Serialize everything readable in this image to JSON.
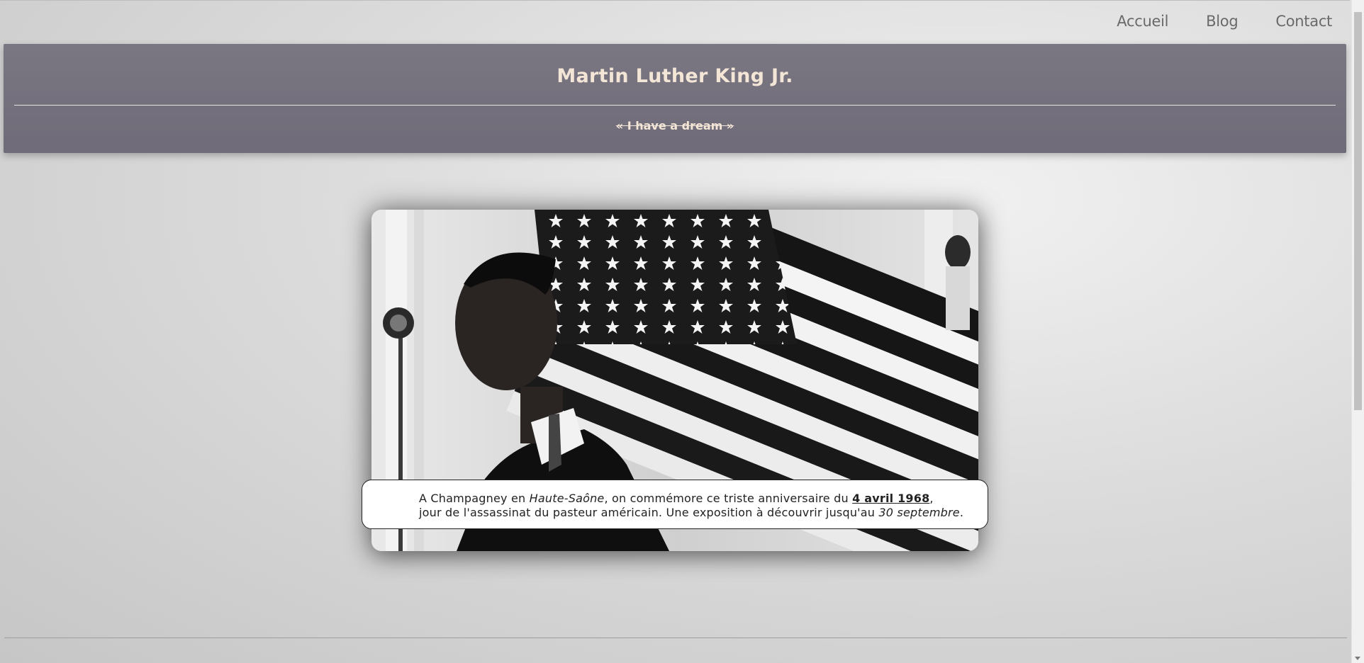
{
  "nav": {
    "items": [
      "Accueil",
      "Blog",
      "Contact"
    ]
  },
  "header": {
    "title": "Martin Luther King Jr.",
    "subtitle": "« I have a dream »"
  },
  "photo": {
    "description_icon": "portrait-photo"
  },
  "caption": {
    "line1_prefix": "A Champagney en ",
    "line1_place": "Haute-Saône",
    "line1_middle": ", on commémore ce triste anniversaire du ",
    "line1_date": "4 avril 1968",
    "line1_suffix": ",",
    "line2_prefix": "jour de l'assassinat du pasteur américain. Une exposition à découvrir jusqu'au ",
    "line2_end_date": "30 septembre",
    "line2_suffix": "."
  },
  "colors": {
    "banner": "#75717d",
    "banner_text": "#f4e6d6",
    "nav_text": "#6a6a6a"
  }
}
